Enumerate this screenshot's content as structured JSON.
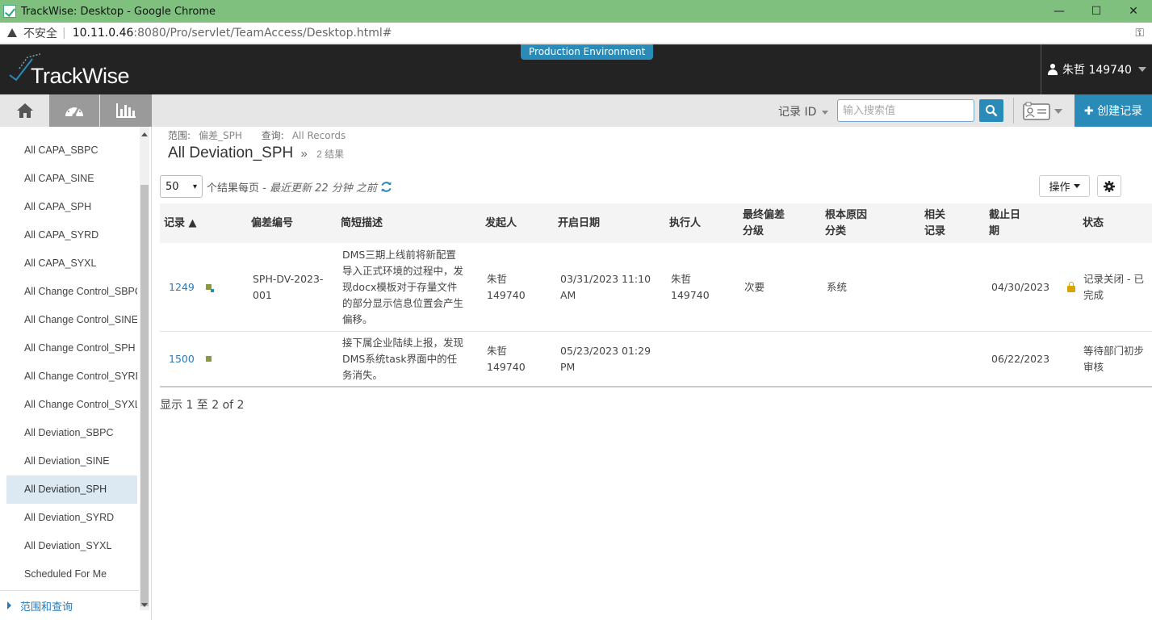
{
  "browser": {
    "window_title": "TrackWise: Desktop - Google Chrome",
    "insecure_label": "不安全",
    "url_host": "10.11.0.46",
    "url_path": ":8080/Pro/servlet/TeamAccess/Desktop.html#"
  },
  "header": {
    "logo_text": "TrackWise",
    "environment_badge": "Production Environment",
    "user_name": "朱哲 149740"
  },
  "toolbar": {
    "record_id_label": "记录 ID",
    "search_placeholder": "输入搜索值",
    "create_label": "✚ 创建记录"
  },
  "sidebar": {
    "items": [
      {
        "label": "All CAPA_SBPC"
      },
      {
        "label": "All CAPA_SINE"
      },
      {
        "label": "All CAPA_SPH"
      },
      {
        "label": "All CAPA_SYRD"
      },
      {
        "label": "All CAPA_SYXL"
      },
      {
        "label": "All Change Control_SBPC"
      },
      {
        "label": "All Change Control_SINE"
      },
      {
        "label": "All Change Control_SPH"
      },
      {
        "label": "All Change Control_SYRD"
      },
      {
        "label": "All Change Control_SYXL"
      },
      {
        "label": "All Deviation_SBPC"
      },
      {
        "label": "All Deviation_SINE"
      },
      {
        "label": "All Deviation_SPH"
      },
      {
        "label": "All Deviation_SYRD"
      },
      {
        "label": "All Deviation_SYXL"
      },
      {
        "label": "Scheduled For Me"
      }
    ],
    "active_index": 12,
    "footer_label": "范围和查询"
  },
  "main": {
    "scope_label": "范围:",
    "scope_value": "偏差_SPH",
    "query_label": "查询:",
    "query_value": "All Records",
    "title": "All Deviation_SPH",
    "title_sep": "»",
    "result_count": "2 结果",
    "per_page_value": "50",
    "per_page_text": "个结果每页",
    "last_updated": "- 最近更新 22 分钟 之前",
    "ops_label": "操作",
    "summary": "显示 1 至 2 of 2"
  },
  "table": {
    "headers": [
      "记录 ▲",
      "偏差编号",
      "简短描述",
      "发起人",
      "开启日期",
      "执行人",
      "最终偏差\n分级",
      "根本原因\n分类",
      "相关\n记录",
      "截止日\n期",
      "状态"
    ],
    "rows": [
      {
        "record": "1249",
        "dev_no": "SPH-DV-2023-001",
        "desc": "DMS三期上线前将新配置导入正式环境的过程中，发现docx模板对于存量文件的部分显示信息位置会产生偏移。",
        "originator": "朱哲 149740",
        "open_date": "03/31/2023 11:10 AM",
        "assignee": "朱哲 149740",
        "classification": "次要",
        "root_cause": "系统",
        "related": "",
        "due_date": "04/30/2023",
        "status": "记录关闭 - 已完成"
      },
      {
        "record": "1500",
        "dev_no": "",
        "desc": "接下属企业陆续上报，发现DMS系统task界面中的任务消失。",
        "originator": "朱哲 149740",
        "open_date": "05/23/2023 01:29 PM",
        "assignee": "",
        "classification": "",
        "root_cause": "",
        "related": "",
        "due_date": "06/22/2023",
        "status": "等待部门初步审核"
      }
    ]
  },
  "colors": {
    "titlebar": "#7fc07f",
    "header_bg": "#232323",
    "accent": "#2a8ab8",
    "link": "#2a7ab8",
    "lock": "#d8a400"
  }
}
